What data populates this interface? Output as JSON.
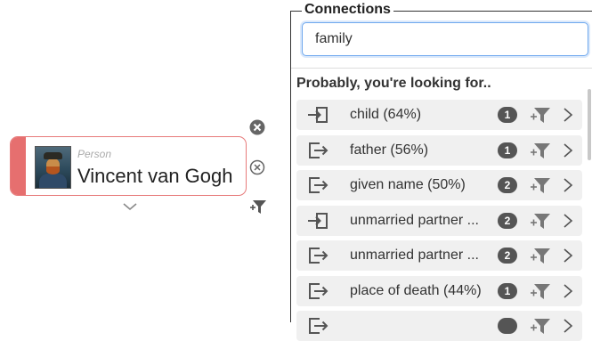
{
  "node": {
    "type_label": "Person",
    "name": "Vincent van Gogh",
    "accent_color": "#e66f6f"
  },
  "panel": {
    "title": "Connections",
    "search": {
      "value": "family",
      "placeholder": ""
    },
    "section_title": "Probably, you're looking for..",
    "rows": [
      {
        "label": "child (64%)",
        "count": "1",
        "direction": "incoming"
      },
      {
        "label": "father (56%)",
        "count": "1",
        "direction": "outgoing"
      },
      {
        "label": "given name (50%)",
        "count": "2",
        "direction": "outgoing"
      },
      {
        "label": "unmarried partner ...",
        "count": "2",
        "direction": "incoming"
      },
      {
        "label": "unmarried partner ...",
        "count": "2",
        "direction": "outgoing"
      },
      {
        "label": "place of death (44%)",
        "count": "1",
        "direction": "outgoing"
      },
      {
        "label": "",
        "count": "",
        "direction": "outgoing"
      }
    ]
  },
  "icons": {
    "close": "close-circle-icon",
    "remove": "remove-circle-icon",
    "filter": "filter-add-icon",
    "expand": "chevron-down-icon",
    "incoming": "link-in-icon",
    "outgoing": "link-out-icon",
    "more": "chevron-right-icon"
  }
}
